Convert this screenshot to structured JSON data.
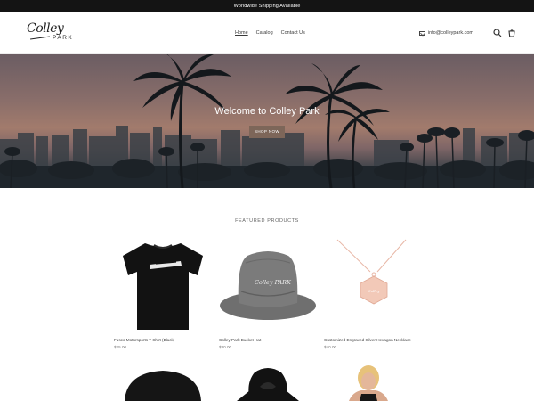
{
  "announcement": "Worldwide Shipping Available",
  "logo": {
    "script": "Colley",
    "sub": "PARK"
  },
  "nav": {
    "home": "Home",
    "catalog": "Catalog",
    "contact": "Contact Us"
  },
  "header": {
    "email": "info@colleypark.com"
  },
  "hero": {
    "title": "Welcome to Colley Park",
    "button": "SHOP NOW"
  },
  "featured": {
    "title": "FEATURED PRODUCTS",
    "products": [
      {
        "name": "Fusco Motorsports T-Shirt (Black)",
        "price": "$25.00"
      },
      {
        "name": "Colley Park Bucket Hat",
        "price": "$30.00"
      },
      {
        "name": "Customized Engraved Silver Hexagon Necklace",
        "price": "$40.00"
      }
    ]
  },
  "bucket_hat_print": "Colley PARK",
  "colors": {
    "announce_bg": "#141414",
    "button_bg": "#7d6659",
    "necklace": "#e8b7a6"
  }
}
